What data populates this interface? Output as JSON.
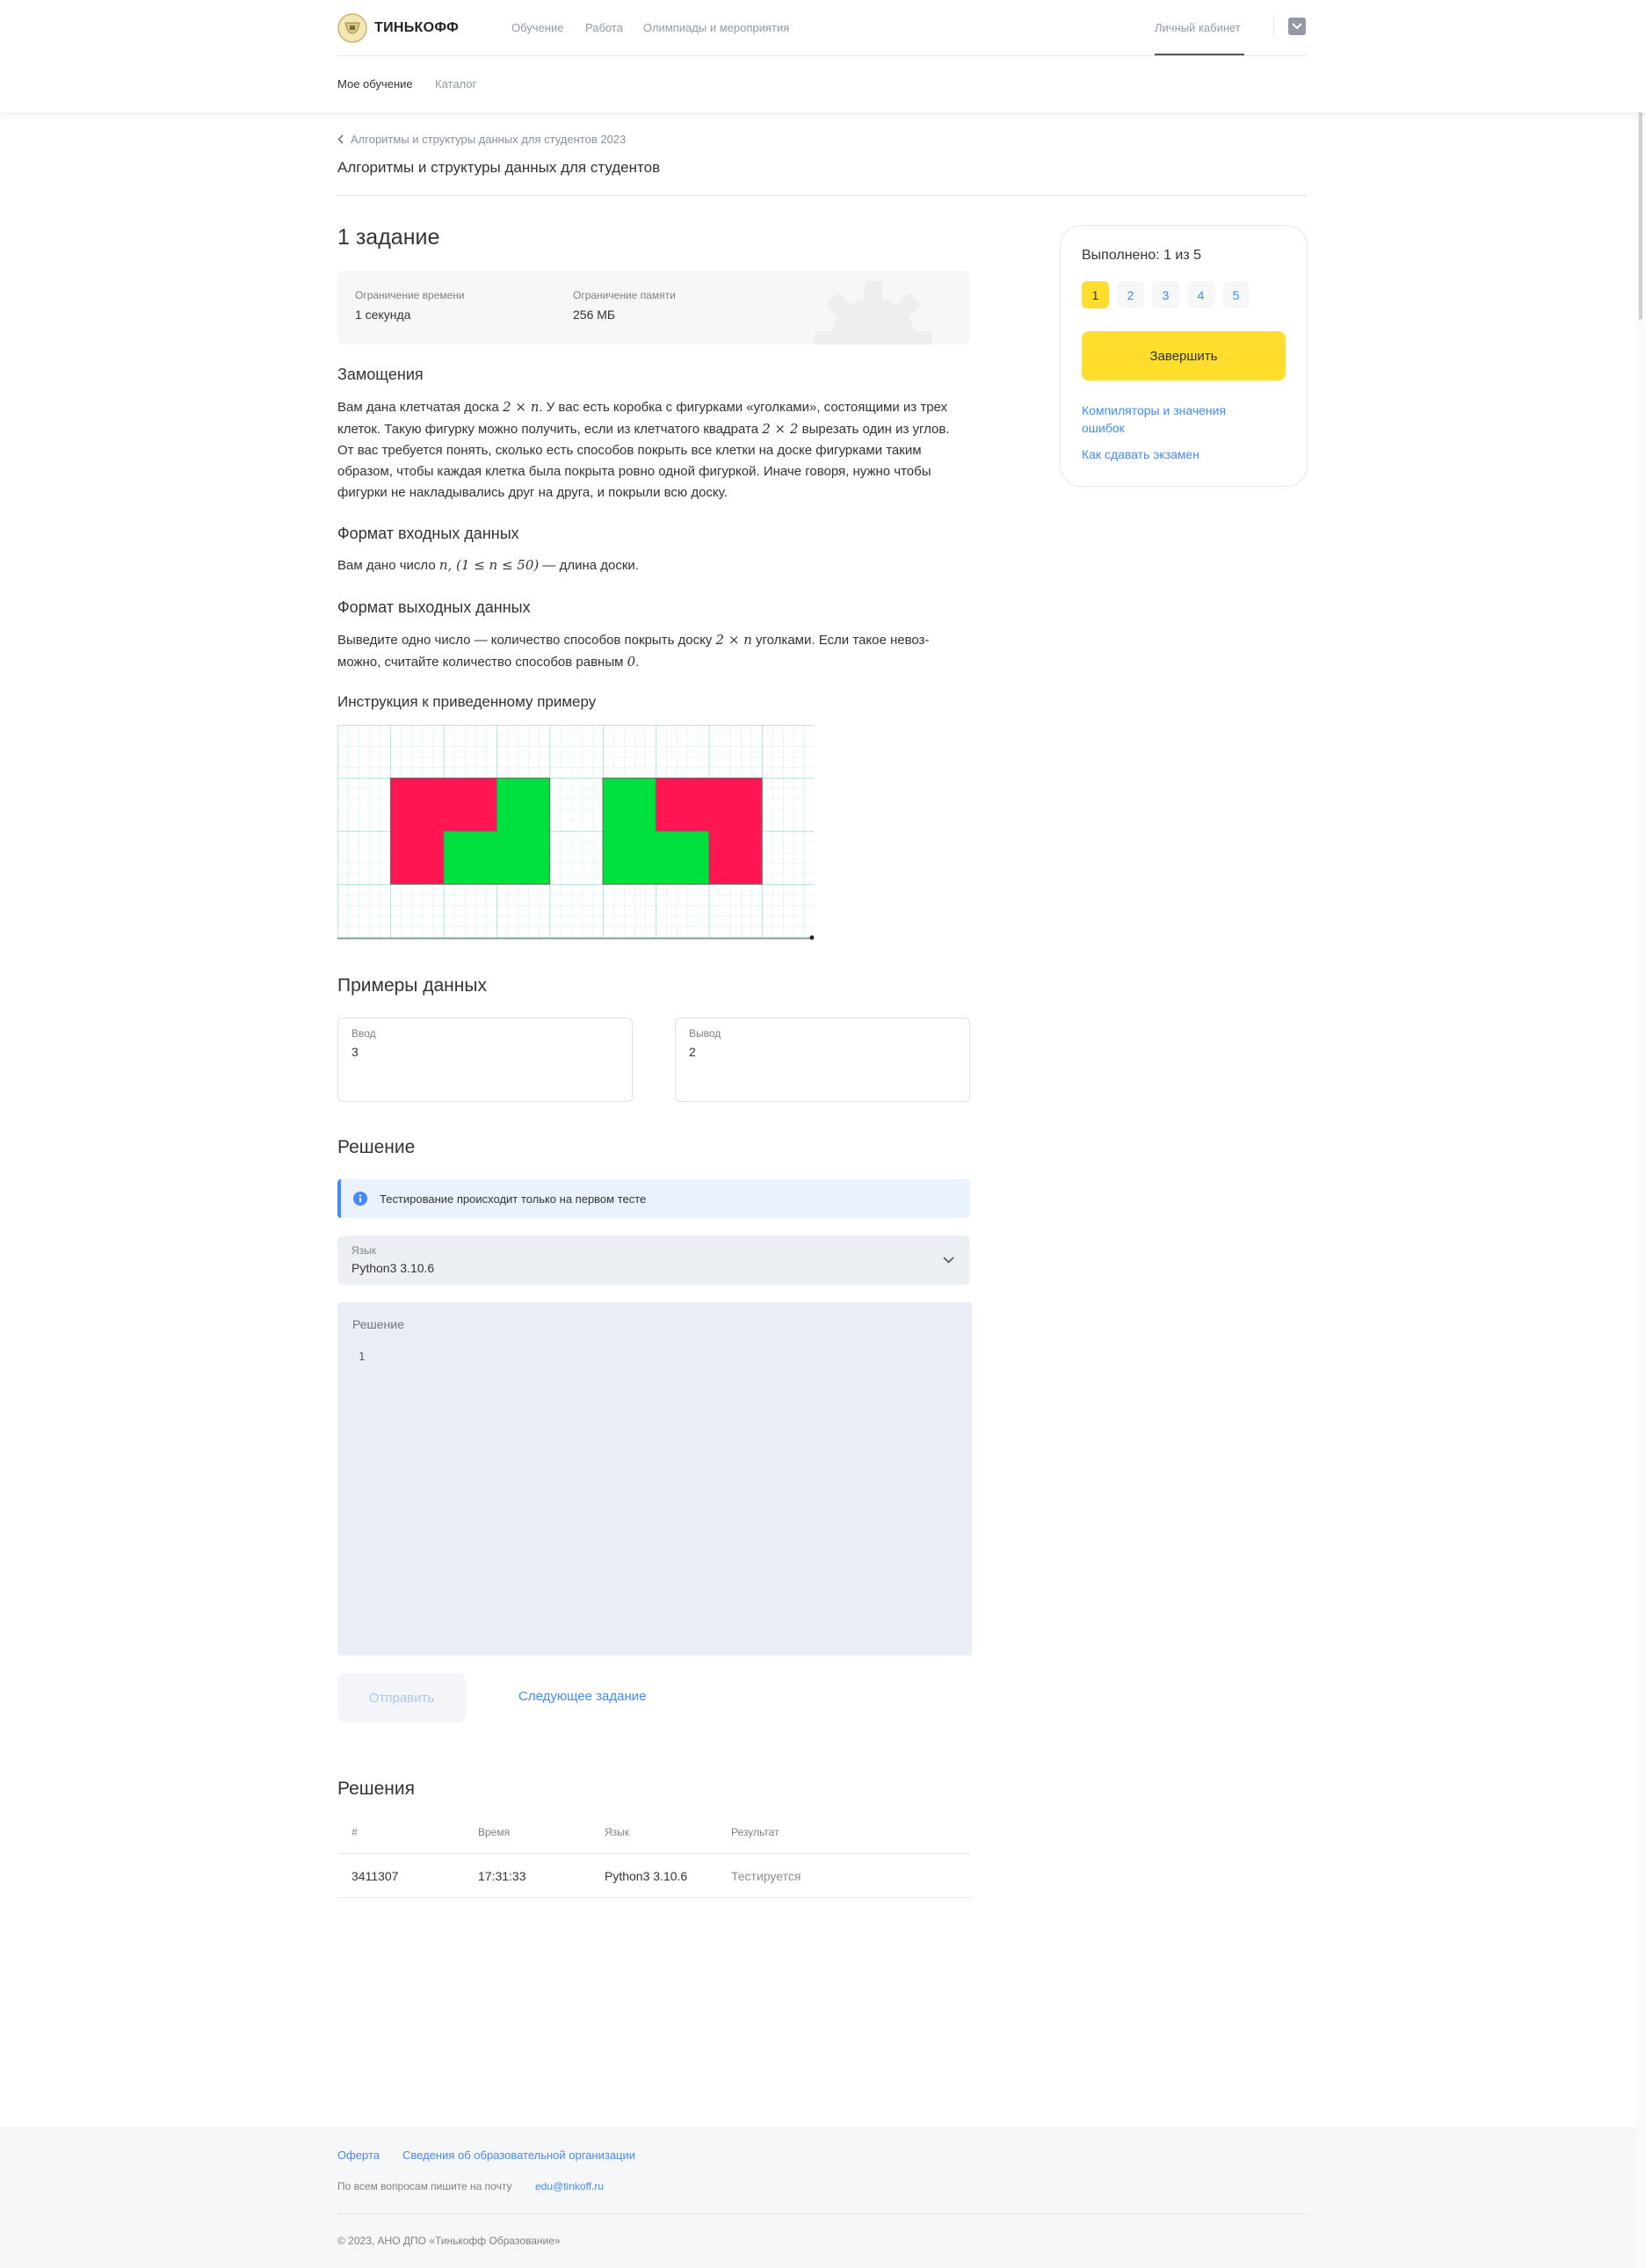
{
  "header": {
    "logo_text": "ТИНЬКОФФ",
    "nav": [
      "Обучение",
      "Работа",
      "Олимпиады и мероприятия"
    ],
    "account": "Личный кабинет",
    "subnav": [
      "Мое обучение",
      "Каталог"
    ]
  },
  "breadcrumb": "Алгоритмы и структуры данных для студентов 2023",
  "course_title": "Алгоритмы и структуры данных для студентов",
  "task": {
    "title": "1 задание",
    "limits": {
      "time_label": "Ограничение времени",
      "time_value": "1 секунда",
      "memory_label": "Ограничение памяти",
      "memory_value": "256 МБ"
    },
    "problem_title": "Замощения",
    "statement": {
      "p1a": "Вам дана клетчатая доска ",
      "m1": "2 × n",
      "p1b": ". У вас есть коробка с фигурками «уголками», состоящими из трех",
      "p2a": "клеток. Такую фигурку можно получить, если из клетчатого квадрата ",
      "m2": "2 × 2",
      "p2b": " вырезать один из углов.",
      "p3": "От вас требуется понять, сколько есть способов покрыть все клетки на доске фигурками таким",
      "p4": "образом, чтобы каждая клетка была покрыта ровно одной фигуркой. Иначе говоря, нужно чтобы",
      "p5": "фигурки не накладывались друг на друга, и покрыли всю доску."
    },
    "input_title": "Формат входных данных",
    "input": {
      "a": "Вам дано число ",
      "m": "n, (1 ≤ n ≤ 50)",
      "b": " — длина доски."
    },
    "output_title": "Формат выходных данных",
    "output": {
      "a": "Выведите одно число — количество способов покрыть доску ",
      "m": "2 × n",
      "b": " уголками. Если такое невоз-",
      "c": "можно, считайте количество способов равным ",
      "m2": "0",
      "d": "."
    },
    "example_title": "Инструкция к приведенному примеру",
    "examples_title": "Примеры данных",
    "sample": {
      "input_label": "Ввод",
      "input_value": "3",
      "output_label": "Вывод",
      "output_value": "2"
    }
  },
  "solution": {
    "title": "Решение",
    "info": "Тестирование происходит только на первом тесте",
    "lang_label": "Язык",
    "lang_value": "Python3 3.10.6",
    "editor_label": "Решение",
    "line_number": "1",
    "submit": "Отправить",
    "next": "Следующее задание"
  },
  "submissions": {
    "title": "Решения",
    "headers": [
      "#",
      "Время",
      "Язык",
      "Результат"
    ],
    "rows": [
      [
        "3411307",
        "17:31:33",
        "Python3 3.10.6",
        "Тестируется"
      ]
    ]
  },
  "sidebar": {
    "progress": "Выполнено: 1 из 5",
    "tasks": [
      "1",
      "2",
      "3",
      "4",
      "5"
    ],
    "finish": "Завершить",
    "link1_l1": "Компиляторы и значения",
    "link1_l2": "ошибок",
    "link2": "Как сдавать экзамен"
  },
  "footer": {
    "link1": "Оферта",
    "link2": "Сведения об образовательной организации",
    "contact": "По всем вопросам пишите на почту",
    "email": "edu@tinkoff.ru",
    "copyright": "© 2023, АНО ДПО «Тинькофф Образование»"
  },
  "colors": {
    "accent_yellow": "#ffdd2d",
    "link_blue": "#428bf9",
    "figure_red": "#ff1552",
    "figure_green": "#00e03e",
    "grid_cyan": "#b8ecec"
  }
}
